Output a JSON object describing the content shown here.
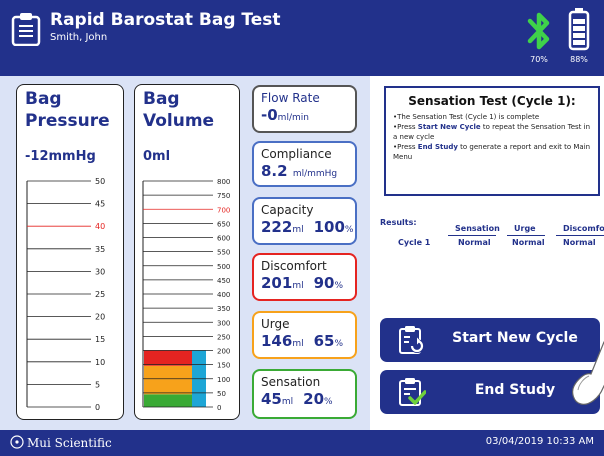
{
  "header": {
    "title": "Rapid Barostat Bag Test",
    "patient": "Smith, John",
    "bluetooth_level": "70%",
    "battery_level": "88%",
    "icons": [
      "clipboard-icon",
      "bluetooth-icon",
      "battery-icon"
    ]
  },
  "gauges": {
    "pressure": {
      "title_line1": "Bag",
      "title_line2": "Pressure",
      "value": "-12mmHg",
      "ticks": [
        "50",
        "45",
        "40",
        "35",
        "30",
        "25",
        "20",
        "15",
        "10",
        "5",
        "0"
      ],
      "highlight_tick": "40",
      "current_level": 0
    },
    "volume": {
      "title_line1": "Bag",
      "title_line2": "Volume",
      "value": "0ml",
      "ticks": [
        "800",
        "750",
        "700",
        "650",
        "600",
        "550",
        "500",
        "450",
        "400",
        "350",
        "300",
        "250",
        "200",
        "150",
        "100",
        "50",
        "0"
      ],
      "highlight_tick": "700",
      "current_level": 0,
      "bands": [
        {
          "name": "sensation",
          "from": 0,
          "to": 45,
          "color": "#3aaa35"
        },
        {
          "name": "urge",
          "from": 45,
          "to": 146,
          "color": "#f7a21b"
        },
        {
          "name": "discomfort",
          "from": 146,
          "to": 201,
          "color": "#e52421"
        }
      ],
      "side_fill_color": "#1ea6d6"
    }
  },
  "cards": {
    "flow_rate": {
      "label": "Flow Rate",
      "value": "-0",
      "unit": "ml/min",
      "border": "#555555"
    },
    "compliance": {
      "label": "Compliance",
      "value": "8.2",
      "unit": "ml/mmHg",
      "border": "#4a6fc4"
    },
    "capacity": {
      "label": "Capacity",
      "value": "222",
      "unit": "ml",
      "pct": "100",
      "pct_unit": "%",
      "border": "#4a6fc4"
    },
    "discomfort": {
      "label": "Discomfort",
      "value": "201",
      "unit": "ml",
      "pct": "90",
      "pct_unit": "%",
      "border": "#e52421"
    },
    "urge": {
      "label": "Urge",
      "value": "146",
      "unit": "ml",
      "pct": "65",
      "pct_unit": "%",
      "border": "#f7a21b"
    },
    "sensation": {
      "label": "Sensation",
      "value": "45",
      "unit": "ml",
      "pct": "20",
      "pct_unit": "%",
      "border": "#3aaa35"
    }
  },
  "info": {
    "title": "Sensation Test (Cycle 1):",
    "line1": "•The Sensation Test (Cycle 1) is complete",
    "line2_pre": "•Press ",
    "line2_hl": "Start New Cycle",
    "line2_post": " to repeat the Sensation Test in",
    "line3": "a new cycle",
    "line4_pre": "•Press ",
    "line4_hl": "End Study",
    "line4_post": " to generate a report and exit to Main",
    "line5": "Menu"
  },
  "results": {
    "label": "Results:",
    "headers": [
      "Sensation",
      "Urge",
      "Discomfort"
    ],
    "rows": [
      {
        "name": "Cycle 1",
        "values": [
          "Normal",
          "Normal",
          "Normal"
        ]
      }
    ]
  },
  "buttons": {
    "start_new_cycle": "Start New Cycle",
    "end_study": "End Study"
  },
  "footer": {
    "brand": "Mui Scientific",
    "timestamp": "03/04/2019 10:33 AM"
  },
  "colors": {
    "brand_blue": "#22318b",
    "panel_bg": "#dbe3f6",
    "highlight_red": "#e52421"
  }
}
